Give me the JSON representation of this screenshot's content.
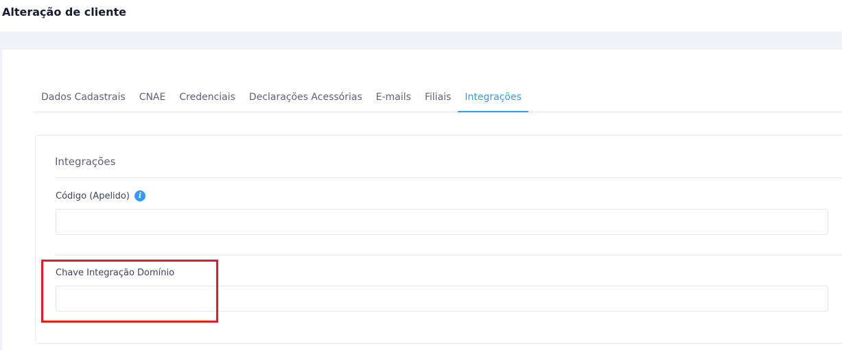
{
  "header": {
    "title": "Alteração de cliente"
  },
  "tabs": [
    {
      "label": "Dados Cadastrais",
      "active": false
    },
    {
      "label": "CNAE",
      "active": false
    },
    {
      "label": "Credenciais",
      "active": false
    },
    {
      "label": "Declarações Acessórias",
      "active": false
    },
    {
      "label": "E-mails",
      "active": false
    },
    {
      "label": "Filiais",
      "active": false
    },
    {
      "label": "Integrações",
      "active": true
    }
  ],
  "panel": {
    "title": "Integrações",
    "fields": [
      {
        "label": "Código (Apelido)",
        "value": "",
        "icon": "info-icon"
      },
      {
        "label": "Chave Integração Domínio",
        "value": ""
      }
    ]
  },
  "colors": {
    "accent": "#3699ff",
    "highlight": "#e02020"
  }
}
